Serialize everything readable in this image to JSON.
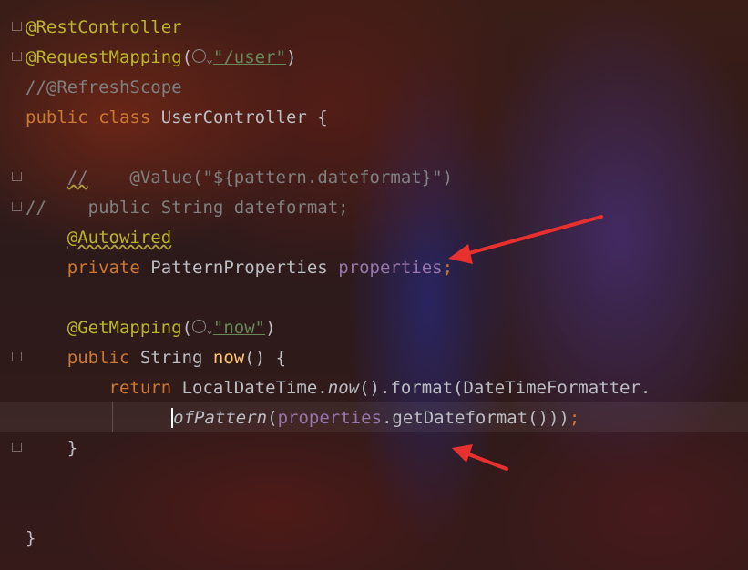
{
  "editor": {
    "lines": [
      {
        "id": "l1",
        "tokens": [
          {
            "text": "@RestController",
            "cls": "ann"
          }
        ]
      },
      {
        "id": "l2",
        "tokens": [
          {
            "text": "@RequestMapping",
            "cls": "ann"
          },
          {
            "text": "("
          },
          {
            "icon": "globe-icon"
          },
          {
            "icon": "chevron-down-icon",
            "text": "⌄"
          },
          {
            "text": "\"/user\"",
            "cls": "str uline"
          },
          {
            "text": ")"
          }
        ]
      },
      {
        "id": "l3",
        "tokens": [
          {
            "text": "//@RefreshScope",
            "cls": "cmt"
          }
        ]
      },
      {
        "id": "l4",
        "tokens": [
          {
            "text": "public ",
            "cls": "kw"
          },
          {
            "text": "class ",
            "cls": "kw"
          },
          {
            "text": "UserController {"
          }
        ]
      },
      {
        "id": "l5",
        "tokens": []
      },
      {
        "id": "l6",
        "tokens": [
          {
            "text": "    "
          },
          {
            "text": "//",
            "cls": "cmt wavy"
          },
          {
            "text": "    @Value(\"${pattern.dateformat}\")",
            "cls": "cmt"
          }
        ]
      },
      {
        "id": "l7",
        "tokens": [
          {
            "text": "//    public String dateformat;",
            "cls": "cmt"
          }
        ]
      },
      {
        "id": "l8",
        "tokens": [
          {
            "text": "    "
          },
          {
            "text": "@Autowired",
            "cls": "ann wavy"
          }
        ]
      },
      {
        "id": "l9",
        "tokens": [
          {
            "text": "    "
          },
          {
            "text": "private ",
            "cls": "kw"
          },
          {
            "text": "PatternProperties "
          },
          {
            "text": "properties",
            "cls": "fld"
          },
          {
            "text": ";",
            "cls": "kw"
          }
        ]
      },
      {
        "id": "l10",
        "tokens": []
      },
      {
        "id": "l11",
        "tokens": [
          {
            "text": "    "
          },
          {
            "text": "@GetMapping",
            "cls": "ann"
          },
          {
            "text": "("
          },
          {
            "icon": "globe-icon"
          },
          {
            "icon": "chevron-down-icon",
            "text": "⌄"
          },
          {
            "text": "\"now\"",
            "cls": "str uline"
          },
          {
            "text": ")"
          }
        ]
      },
      {
        "id": "l12",
        "tokens": [
          {
            "text": "    "
          },
          {
            "text": "public ",
            "cls": "kw"
          },
          {
            "text": "String "
          },
          {
            "text": "now",
            "cls": "fn"
          },
          {
            "text": "() {"
          }
        ]
      },
      {
        "id": "l13",
        "tokens": [
          {
            "text": "        "
          },
          {
            "text": "return ",
            "cls": "kw"
          },
          {
            "text": "LocalDateTime."
          },
          {
            "text": "now",
            "cls": "ital"
          },
          {
            "text": "().format(DateTimeFormatter."
          }
        ]
      },
      {
        "id": "l14",
        "tokens": [
          {
            "text": "              "
          },
          {
            "text": "o",
            "cls": "ital caret"
          },
          {
            "text": "fPattern",
            "cls": "ital"
          },
          {
            "text": "("
          },
          {
            "text": "properties",
            "cls": "fld"
          },
          {
            "text": ".getDateformat()))"
          },
          {
            "text": ";",
            "cls": "kw"
          }
        ]
      },
      {
        "id": "l15",
        "tokens": [
          {
            "text": "    }"
          }
        ]
      },
      {
        "id": "l16",
        "tokens": []
      },
      {
        "id": "l17",
        "tokens": []
      },
      {
        "id": "l18",
        "tokens": [
          {
            "text": "}"
          }
        ]
      }
    ]
  },
  "colors": {
    "annotation": "#bbb529",
    "keyword": "#cc7832",
    "method": "#ffc66d",
    "string": "#6a8759",
    "comment": "#808080",
    "field": "#9876aa",
    "text": "#bcbec4",
    "arrow": "#e8302e"
  }
}
